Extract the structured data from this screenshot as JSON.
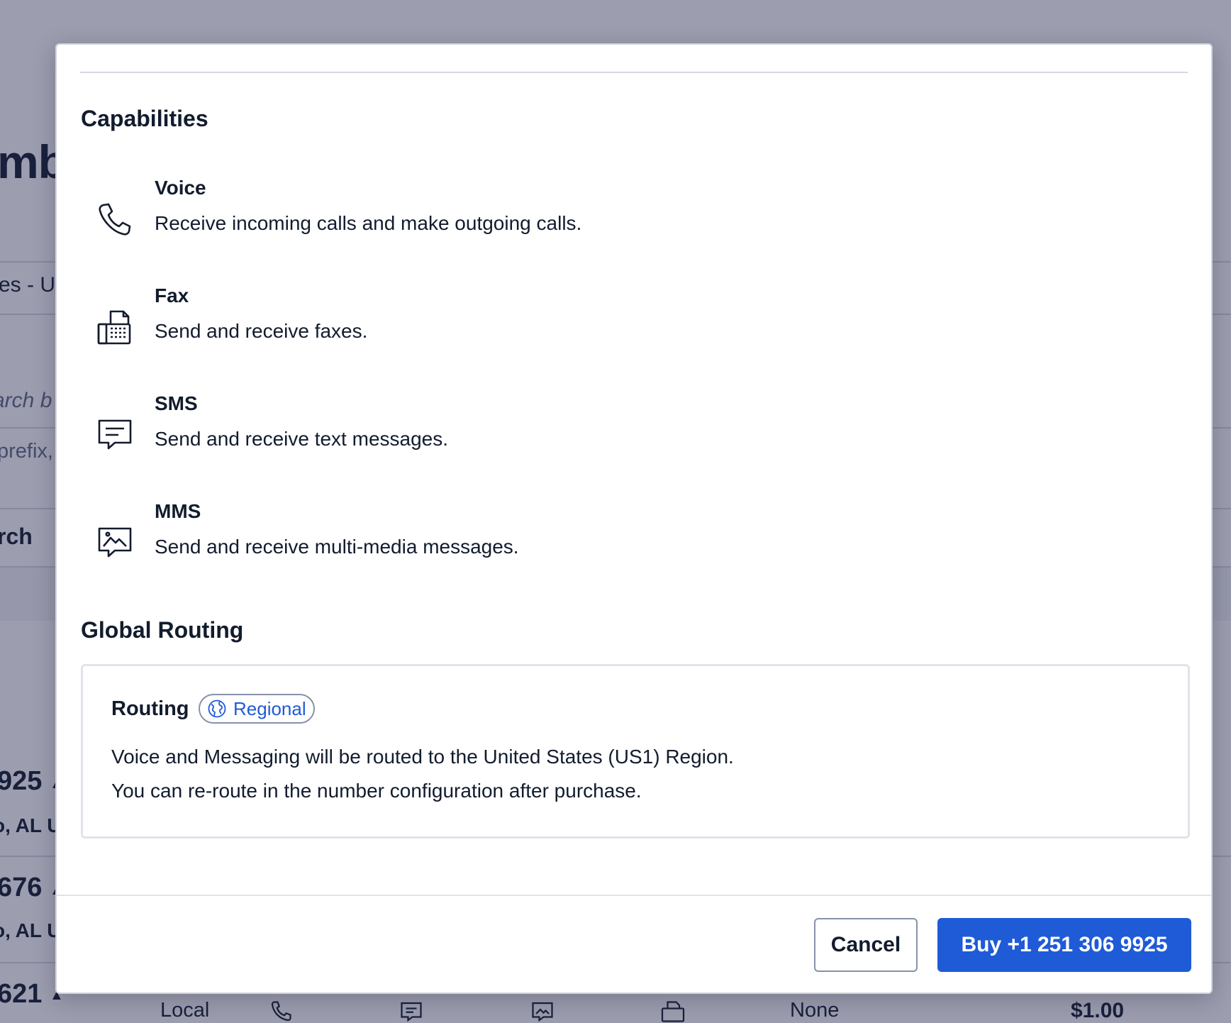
{
  "background": {
    "page_title_fragment": "mb",
    "select_fragment": "es - U",
    "search_placeholder_fragment": "arch b",
    "hint_fragment": "prefix,",
    "search_button_fragment": "rch",
    "rows": [
      {
        "number_fragment": "925",
        "location_fragment": "o, AL U"
      },
      {
        "number_fragment": "676",
        "location_fragment": "o, AL U"
      },
      {
        "number_fragment": "621"
      }
    ],
    "last_row": {
      "type": "Local",
      "address_requirement": "None",
      "price": "$1.00"
    }
  },
  "modal": {
    "capabilities_heading": "Capabilities",
    "capabilities": [
      {
        "name": "Voice",
        "description": "Receive incoming calls and make outgoing calls.",
        "icon": "phone-icon"
      },
      {
        "name": "Fax",
        "description": "Send and receive faxes.",
        "icon": "fax-icon"
      },
      {
        "name": "SMS",
        "description": "Send and receive text messages.",
        "icon": "sms-icon"
      },
      {
        "name": "MMS",
        "description": "Send and receive multi-media messages.",
        "icon": "mms-icon"
      }
    ],
    "global_routing_heading": "Global Routing",
    "routing": {
      "label": "Routing",
      "badge": "Regional",
      "line1": "Voice and Messaging will be routed to the United States (US1) Region.",
      "line2": "You can re-route in the number configuration after purchase."
    },
    "footer": {
      "cancel_label": "Cancel",
      "buy_label": "Buy +1 251 306 9925"
    }
  },
  "colors": {
    "primary": "#1f5bd6",
    "text": "#121c2d",
    "overlay": "#24264e"
  }
}
